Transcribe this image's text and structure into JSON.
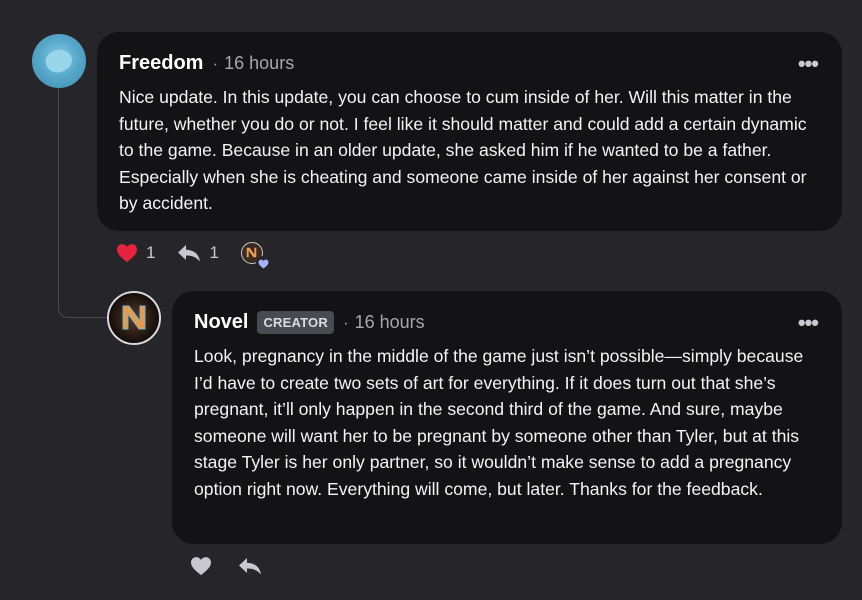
{
  "comments": {
    "parent": {
      "author": "Freedom",
      "separator": "·",
      "time": "16 hours",
      "more_label": "•••",
      "text": "Nice update. In this update, you can choose to cum inside of her. Will this matter in the future, whether you do or not. I feel like it should matter and could add a certain dynamic to the game. Because in an older update, she asked him if he wanted to be a father. Especially when she is cheating and someone came inside of her against her consent or by accident.",
      "likes": "1",
      "replies": "1",
      "liked": true
    },
    "reply": {
      "author": "Novel",
      "badge": "CREATOR",
      "separator": "·",
      "time": "16 hours",
      "more_label": "•••",
      "text": "Look, pregnancy in the middle of the game just isn’t possible—simply because I’d have to create two sets of art for everything. If it does turn out that she’s pregnant, it’ll only happen in the second third of the game. And sure, maybe someone will want her to be pregnant by someone other than Tyler, but at this stage Tyler is her only partner, so it wouldn’t make sense to add a pregnancy option right now. Everything will come, but later. Thanks for the feedback."
    }
  },
  "colors": {
    "background": "#26262a",
    "card": "#131316",
    "heart_active": "#e8233f",
    "icon": "#c8c8ce"
  },
  "icons": [
    "heart-icon",
    "reply-icon",
    "more-icon",
    "creator-heart-icon"
  ]
}
